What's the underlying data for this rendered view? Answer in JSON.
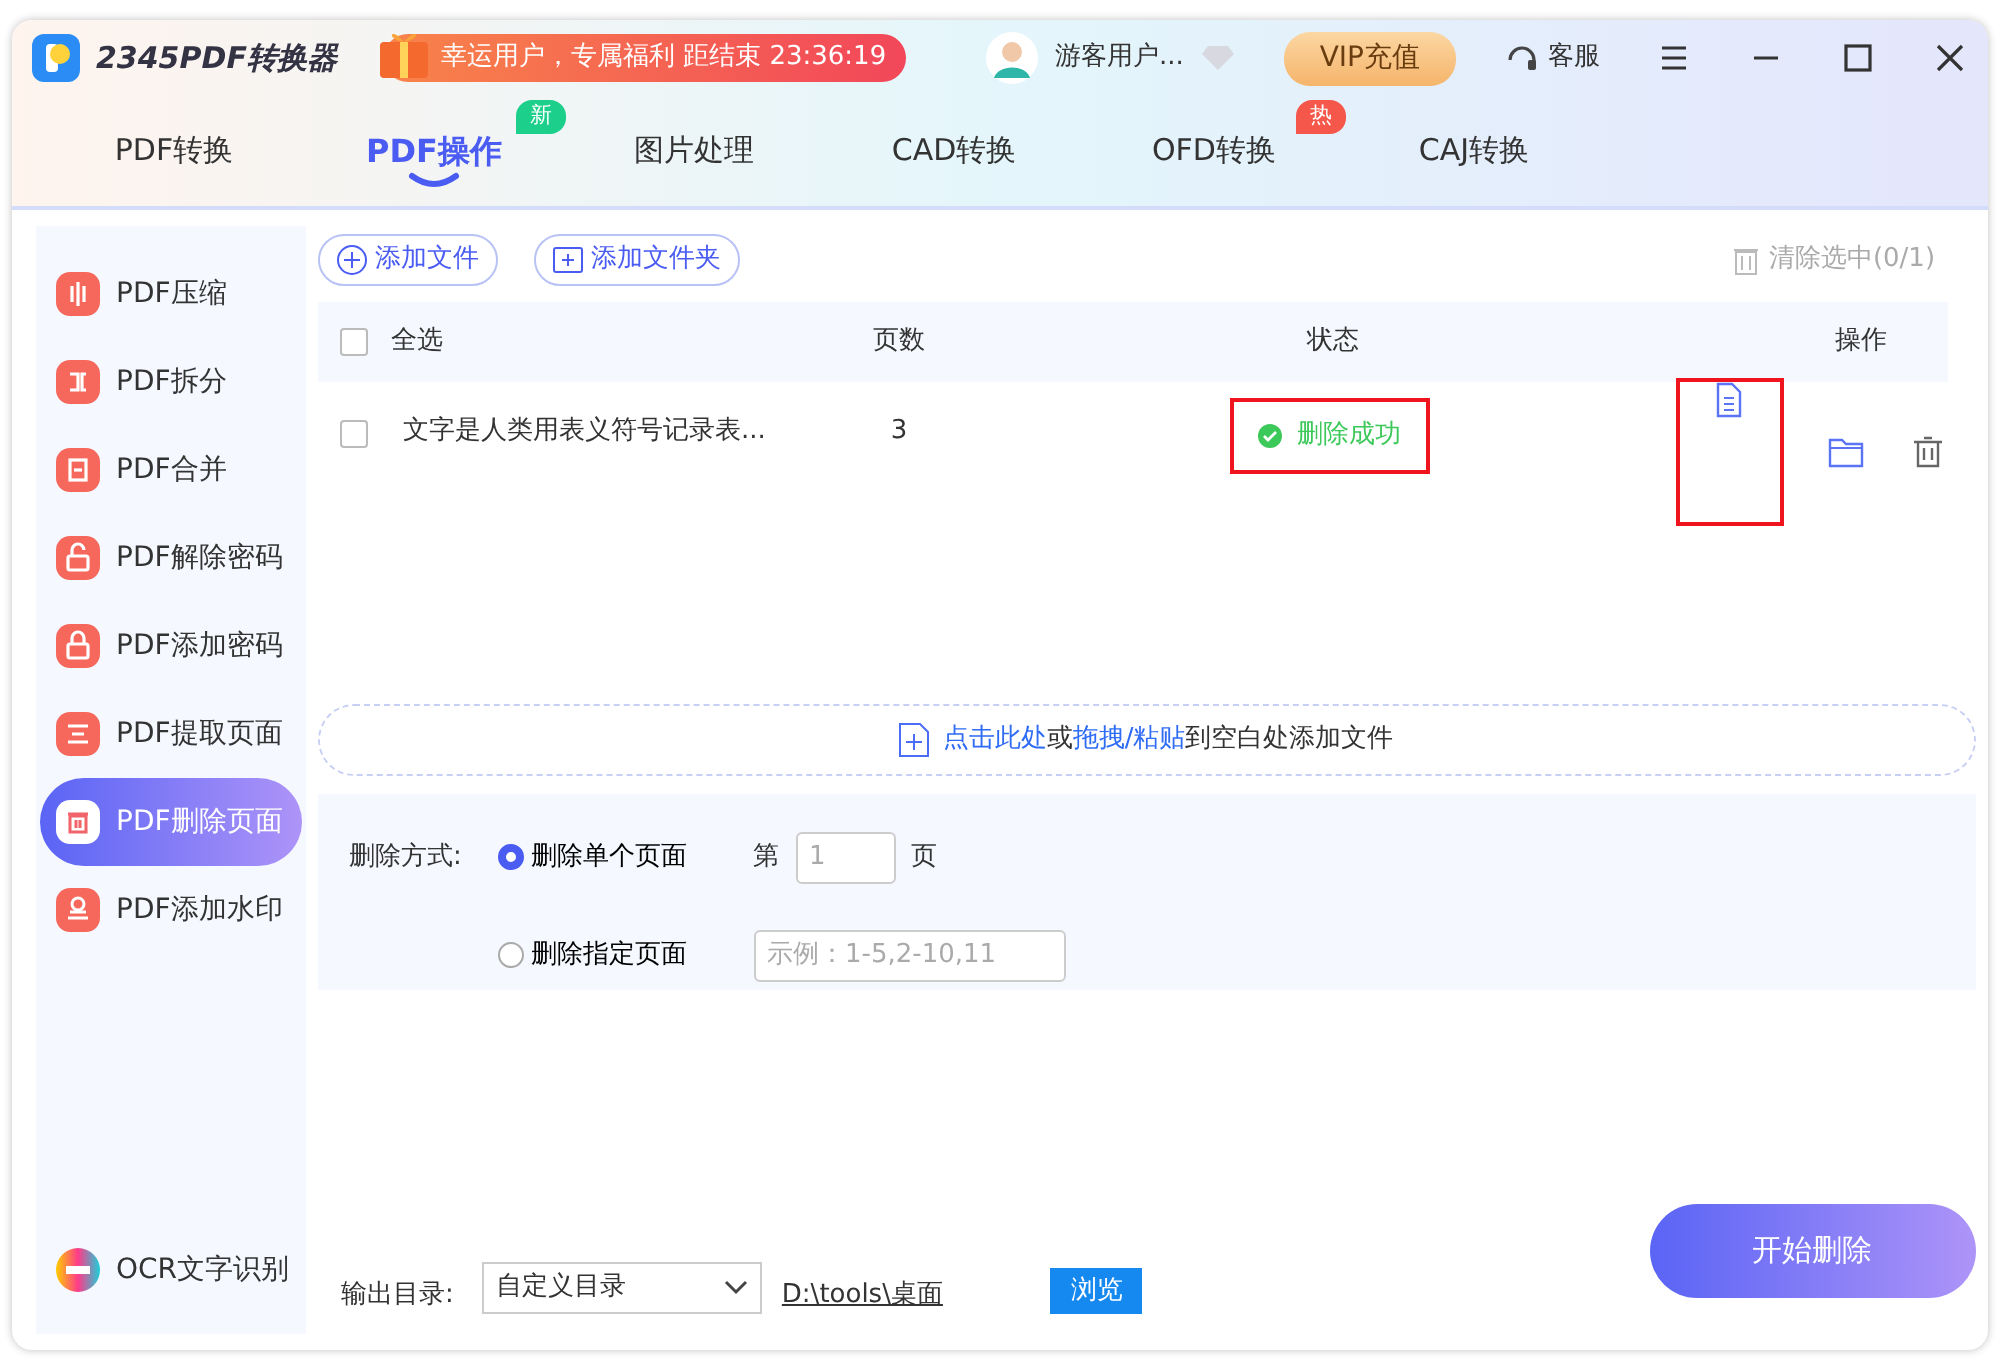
{
  "app": {
    "title": "2345PDF转换器",
    "promo": "幸运用户，专属福利 距结束 23:36:19",
    "user": "游客用户...",
    "vip_button": "VIP充值",
    "service": "客服"
  },
  "tabs": [
    {
      "label": "PDF转换",
      "selected": false
    },
    {
      "label": "PDF操作",
      "selected": true,
      "badge": "新",
      "color": "#1ccf8a"
    },
    {
      "label": "图片处理",
      "selected": false
    },
    {
      "label": "CAD转换",
      "selected": false
    },
    {
      "label": "OFD转换",
      "selected": false,
      "badge": "热",
      "color": "#f5574a"
    },
    {
      "label": "CAJ转换",
      "selected": false
    }
  ],
  "sidebar": {
    "items": [
      {
        "label": "PDF压缩",
        "kind": "compress",
        "selected": false
      },
      {
        "label": "PDF拆分",
        "kind": "split",
        "selected": false
      },
      {
        "label": "PDF合并",
        "kind": "merge",
        "selected": false
      },
      {
        "label": "PDF解除密码",
        "kind": "unlock",
        "selected": false
      },
      {
        "label": "PDF添加密码",
        "kind": "lock",
        "selected": false
      },
      {
        "label": "PDF提取页面",
        "kind": "extract",
        "selected": false
      },
      {
        "label": "PDF删除页面",
        "kind": "delete",
        "selected": true
      },
      {
        "label": "PDF添加水印",
        "kind": "stamp",
        "selected": false
      }
    ],
    "footer": "OCR文字识别"
  },
  "toolbar": {
    "add_file": "添加文件",
    "add_folder": "添加文件夹",
    "clear": "清除选中(0/1)"
  },
  "table": {
    "select_all": {
      "label": "全选",
      "checked": false
    },
    "columns": [
      "页数",
      "状态",
      "操作"
    ],
    "rows": [
      {
        "checked": false,
        "name": "文字是人类用表义符号记录表...",
        "pages": "3",
        "status": "删除成功",
        "status_highlighted": true,
        "actions": [
          {
            "kind": "view",
            "highlighted": true
          },
          {
            "kind": "folder",
            "highlighted": false
          },
          {
            "kind": "delete",
            "highlighted": false
          }
        ]
      }
    ]
  },
  "dropzone": [
    {
      "text": "点击此处",
      "kind": "link"
    },
    {
      "text": "或",
      "kind": "plain"
    },
    {
      "text": "拖拽/粘贴",
      "kind": "link"
    },
    {
      "text": "到空白处添加文件",
      "kind": "plain"
    }
  ],
  "options": {
    "label": "删除方式:",
    "modes": [
      {
        "label": "删除单个页面",
        "selected": true
      },
      {
        "label": "删除指定页面",
        "selected": false
      }
    ],
    "page_prefix": "第",
    "page_placeholder": "1",
    "page_suffix": "页",
    "range_placeholder": "示例：1-5,2-10,11"
  },
  "output": {
    "label": "输出目录:",
    "select": "自定义目录",
    "path": "D:\\tools\\桌面",
    "browse": "浏览",
    "start": "开始删除"
  }
}
